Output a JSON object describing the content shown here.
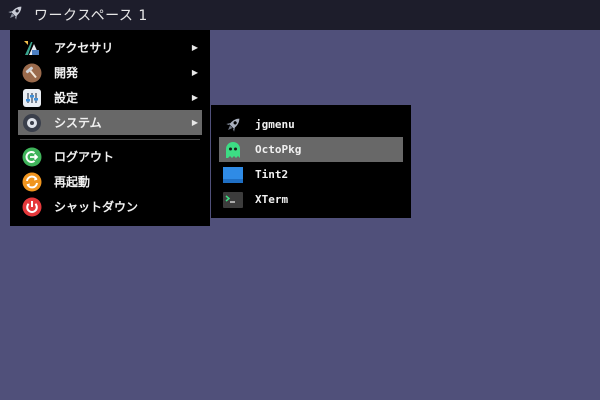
{
  "panel": {
    "launcher_icon": "rocket-icon",
    "workspace_label": "ワークスペース 1"
  },
  "main_menu": {
    "items": [
      {
        "label": "アクセサリ",
        "icon": "accessories-icon",
        "has_submenu": true
      },
      {
        "label": "開発",
        "icon": "development-icon",
        "has_submenu": true
      },
      {
        "label": "設定",
        "icon": "settings-icon",
        "has_submenu": true
      },
      {
        "label": "システム",
        "icon": "system-icon",
        "has_submenu": true,
        "selected": true
      }
    ],
    "session_items": [
      {
        "label": "ログアウト",
        "icon": "logout-icon"
      },
      {
        "label": "再起動",
        "icon": "reboot-icon"
      },
      {
        "label": "シャットダウン",
        "icon": "shutdown-icon"
      }
    ],
    "submenu_arrow": "▶"
  },
  "system_submenu": {
    "items": [
      {
        "label": "jgmenu",
        "icon": "rocket-icon"
      },
      {
        "label": "OctoPkg",
        "icon": "octopkg-icon",
        "selected": true
      },
      {
        "label": "Tint2",
        "icon": "tint2-icon"
      },
      {
        "label": "XTerm",
        "icon": "terminal-icon"
      }
    ]
  },
  "colors": {
    "desktop_background": "#50507a",
    "panel_background": "#1d1d2b",
    "menu_background": "#000000",
    "selected_item": "#686868"
  }
}
